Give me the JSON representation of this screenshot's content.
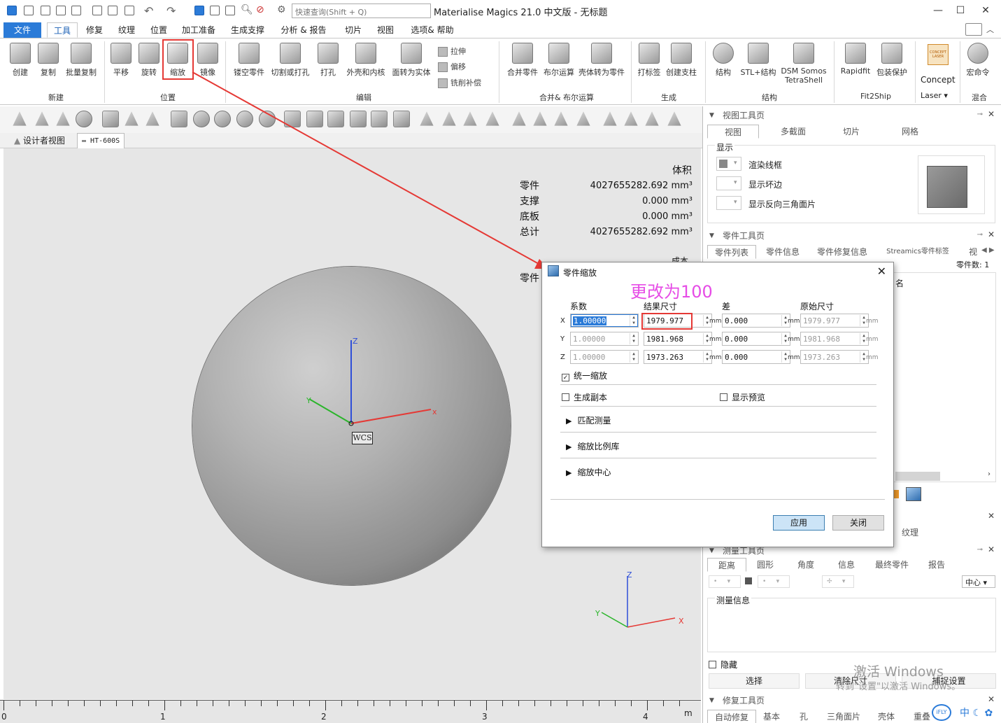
{
  "title_bar": {
    "search_placeholder": "快速查询(Shift + Q)",
    "app_title": "Materialise Magics 21.0 中文版 - 无标题",
    "minimize": "—",
    "maximize": "☐",
    "close": "✕"
  },
  "menu": [
    "文件",
    "工具",
    "修复",
    "纹理",
    "位置",
    "加工准备",
    "生成支撑",
    "分析 & 报告",
    "切片",
    "视图",
    "选项& 帮助"
  ],
  "ribbon": {
    "new_group": {
      "label": "新建",
      "buttons": [
        "创建",
        "复制",
        "批量复制"
      ]
    },
    "position_group": {
      "label": "位置",
      "buttons": [
        "平移",
        "旋转",
        "缩放",
        "镜像"
      ]
    },
    "edit_group": {
      "label": "编辑",
      "buttons": [
        "镂空零件",
        "切割或打孔",
        "打孔",
        "外壳和内核",
        "面转为实体"
      ],
      "small": [
        "拉伸",
        "偏移",
        "铣削补偿"
      ]
    },
    "merge_group": {
      "label": "合并& 布尔运算",
      "buttons": [
        "合并零件",
        "布尔运算",
        "壳体转为零件"
      ]
    },
    "generate_group": {
      "label": "生成",
      "buttons": [
        "打标签",
        "创建支柱"
      ]
    },
    "structure_group": {
      "label": "结构",
      "buttons": [
        "结构",
        "STL+结构",
        "DSM Somos",
        "TetraShell"
      ]
    },
    "fit2ship_group": {
      "label": "Fit2Ship",
      "buttons": [
        "Rapidfit",
        "包装保护"
      ]
    },
    "concept": {
      "label": "Concept",
      "sub": "Laser",
      "logo": "CONCEPT LASER"
    },
    "mix_group": {
      "label": "混合",
      "buttons": [
        "宏命令"
      ]
    }
  },
  "view_tabs": [
    "设计者视图",
    "HT-600S"
  ],
  "volume": {
    "header": "体积",
    "rows": [
      {
        "label": "零件",
        "value": "4027655282.692 mm³"
      },
      {
        "label": "支撑",
        "value": "0.000 mm³"
      },
      {
        "label": "底板",
        "value": "0.000 mm³"
      },
      {
        "label": "总计",
        "value": "4027655282.692 mm³"
      }
    ],
    "partial_label": "零件",
    "partial_right": "成本"
  },
  "viewport": {
    "wcs": "WCS",
    "axes": {
      "x": "x",
      "y": "Y",
      "z": "Z"
    },
    "mini_axes": {
      "x": "X",
      "y": "Y",
      "z": "Z"
    },
    "colors": {
      "x": "#e53935",
      "y": "#2bb52b",
      "z": "#2f4fd8"
    }
  },
  "ruler": {
    "labels": [
      "0",
      "1",
      "2",
      "3",
      "4"
    ],
    "unit": "m"
  },
  "view_toolpage": {
    "title": "视图工具页",
    "tabs": [
      "视图",
      "多截面",
      "切片",
      "网格"
    ],
    "display_label": "显示",
    "items": [
      "渲染线框",
      "显示坏边",
      "显示反向三角面片"
    ]
  },
  "part_toolpage": {
    "title": "零件工具页",
    "tabs": [
      "零件列表",
      "零件信息",
      "零件修复信息",
      "Streamics零件标签",
      "视"
    ],
    "count_label": "零件数:",
    "count": "1",
    "col_name": "名",
    "tex_label": "纹理"
  },
  "measure_toolpage": {
    "title": "测量工具页",
    "tabs": [
      "距离",
      "圆形",
      "角度",
      "信息",
      "最终零件",
      "报告"
    ],
    "center_mode": "中心",
    "info_label": "测量信息",
    "hide_label": "隐藏",
    "select_btn": "选择",
    "clear_btn": "清除尺寸",
    "snap_btn": "捕捉设置"
  },
  "repair_toolpage": {
    "title": "修复工具页",
    "tabs": [
      "自动修复",
      "基本",
      "孔",
      "三角面片",
      "壳体",
      "重叠"
    ]
  },
  "scale_dialog": {
    "title": "零件缩放",
    "annotation": "更改为100",
    "col_headers": [
      "系数",
      "结果尺寸",
      "差",
      "原始尺寸"
    ],
    "rows": [
      {
        "axis": "X",
        "factor": "1.00000",
        "result": "1979.977",
        "diff": "0.000",
        "original": "1979.977"
      },
      {
        "axis": "Y",
        "factor": "1.00000",
        "result": "1981.968",
        "diff": "0.000",
        "original": "1981.968"
      },
      {
        "axis": "Z",
        "factor": "1.00000",
        "result": "1973.263",
        "diff": "0.000",
        "original": "1973.263"
      }
    ],
    "unit": "mm",
    "uniform_label": "统一缩放",
    "uniform_checked": true,
    "copy_label": "生成副本",
    "preview_label": "显示预览",
    "sections": [
      "匹配测量",
      "缩放比例库",
      "缩放中心"
    ],
    "apply": "应用",
    "close": "关闭"
  },
  "activation": {
    "line1": "激活 Windows",
    "line2": "转到\"设置\"以激活 Windows。"
  },
  "taskbar": {
    "ime": "中",
    "ifly": "iFLY"
  }
}
